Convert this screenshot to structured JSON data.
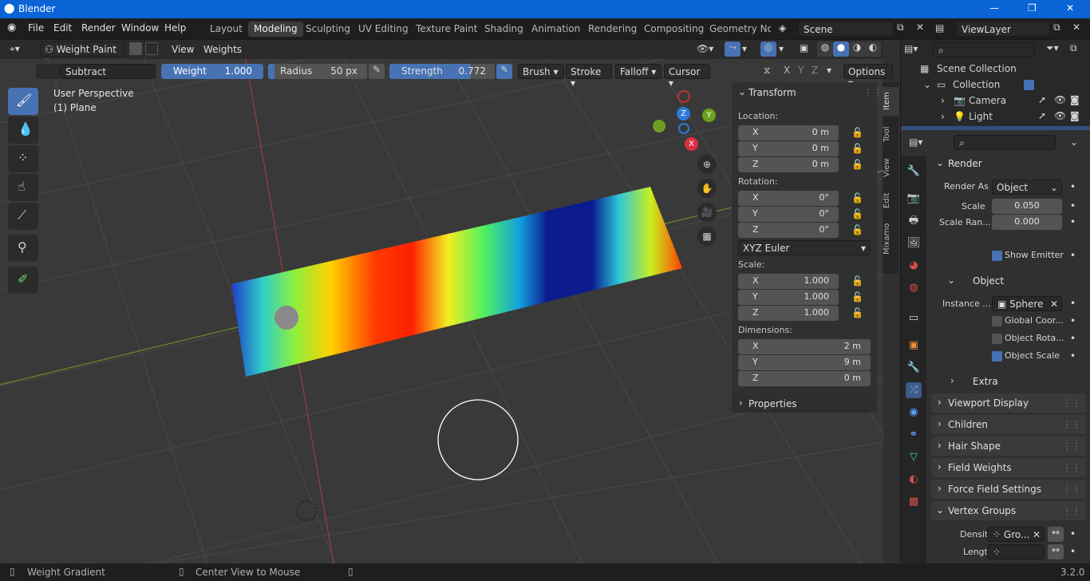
{
  "titlebar": {
    "title": "Blender",
    "minimize": "—",
    "maximize": "❐",
    "close": "✕"
  },
  "menu": [
    "File",
    "Edit",
    "Render",
    "Window",
    "Help"
  ],
  "workspaces": [
    "Layout",
    "Modeling",
    "Sculpting",
    "UV Editing",
    "Texture Paint",
    "Shading",
    "Animation",
    "Rendering",
    "Compositing",
    "Geometry Noc"
  ],
  "scene": "Scene",
  "view_layer": "ViewLayer",
  "header": {
    "mode": "Weight Paint",
    "view": "View",
    "weights": "Weights"
  },
  "tool": {
    "blend": "Subtract",
    "weight_label": "Weight",
    "weight_value": "1.000",
    "radius_label": "Radius",
    "radius_value": "50 px",
    "strength_label": "Strength",
    "strength_value": "0.772",
    "brush": "Brush",
    "stroke": "Stroke",
    "falloff": "Falloff",
    "cursor": "Cursor",
    "options": "Options",
    "x": "X",
    "y": "Y",
    "z": "Z"
  },
  "viewport": {
    "persp": "User Perspective",
    "object": "(1) Plane",
    "gizmo_x": "X",
    "gizmo_y": "Y",
    "gizmo_z": "Z"
  },
  "transform": {
    "title": "Transform",
    "location": "Location:",
    "rotation": "Rotation:",
    "scale": "Scale:",
    "dimensions": "Dimensions:",
    "euler": "XYZ Euler",
    "properties": "Properties",
    "loc": [
      {
        "axis": "X",
        "value": "0 m"
      },
      {
        "axis": "Y",
        "value": "0 m"
      },
      {
        "axis": "Z",
        "value": "0 m"
      }
    ],
    "rot": [
      {
        "axis": "X",
        "value": "0°"
      },
      {
        "axis": "Y",
        "value": "0°"
      },
      {
        "axis": "Z",
        "value": "0°"
      }
    ],
    "scl": [
      {
        "axis": "X",
        "value": "1.000"
      },
      {
        "axis": "Y",
        "value": "1.000"
      },
      {
        "axis": "Z",
        "value": "1.000"
      }
    ],
    "dim": [
      {
        "axis": "X",
        "value": "2 m"
      },
      {
        "axis": "Y",
        "value": "9 m"
      },
      {
        "axis": "Z",
        "value": "0 m"
      }
    ]
  },
  "ntabs": [
    "Item",
    "Tool",
    "View",
    "Edit",
    "Mixamo"
  ],
  "outliner": {
    "scene_collection": "Scene Collection",
    "collection": "Collection",
    "camera": "Camera",
    "light": "Light"
  },
  "props": {
    "render": "Render",
    "render_as_label": "Render As",
    "render_as": "Object",
    "scale_label": "Scale",
    "scale": "0.050",
    "scale_rand_label": "Scale Ran...",
    "scale_rand": "0.000",
    "show_emitter": "Show Emitter",
    "object": "Object",
    "instance_label": "Instance ...",
    "instance": "Sphere",
    "global_coord": "Global Coor...",
    "object_rot": "Object Rota...",
    "object_scale": "Object Scale",
    "extra": "Extra",
    "viewport_display": "Viewport Display",
    "children": "Children",
    "hair_shape": "Hair Shape",
    "field_weights": "Field Weights",
    "force_field": "Force Field Settings",
    "vertex_groups": "Vertex Groups",
    "density_label": "Density",
    "density": "Gro...",
    "length_label": "Length"
  },
  "status": {
    "left": "Weight Gradient",
    "middle": "Center View to Mouse",
    "version": "3.2.0"
  },
  "colors": {
    "accent": "#4772b3",
    "titlebar": "#0a64d6"
  }
}
